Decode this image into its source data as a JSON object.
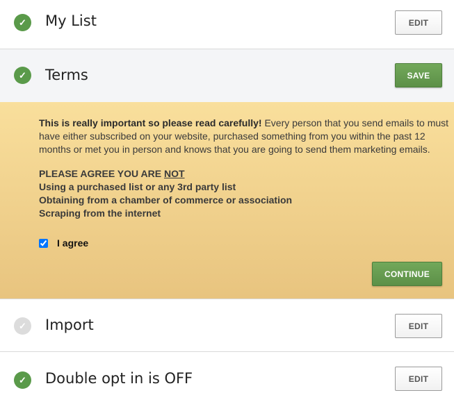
{
  "steps": [
    {
      "title": "My List",
      "status": "done",
      "button": "EDIT"
    },
    {
      "title": "Terms",
      "status": "done",
      "button": "SAVE"
    },
    {
      "title": "Import",
      "status": "pending",
      "button": "EDIT"
    },
    {
      "title": "Double opt in is OFF",
      "status": "done",
      "button": "EDIT"
    }
  ],
  "icons": {
    "check": "check-icon",
    "done_color": "#5a9a4a",
    "pending_color": "#dcdcdc"
  },
  "terms": {
    "intro_bold": "This is really important so please read carefully!",
    "intro_text": " Every person that you send emails to must have either subscribed on your website, purchased something from you within the past 12 months or met you in person and knows that you are going to send them marketing emails.",
    "agree_heading_prefix": "PLEASE AGREE YOU ARE ",
    "agree_heading_not": "NOT",
    "agree_items": [
      "Using a purchased list or any 3rd party list",
      "Obtaining from a chamber of commerce or association",
      "Scraping from the internet"
    ],
    "checkbox_label": "I agree",
    "checkbox_checked": true,
    "continue_label": "CONTINUE"
  }
}
